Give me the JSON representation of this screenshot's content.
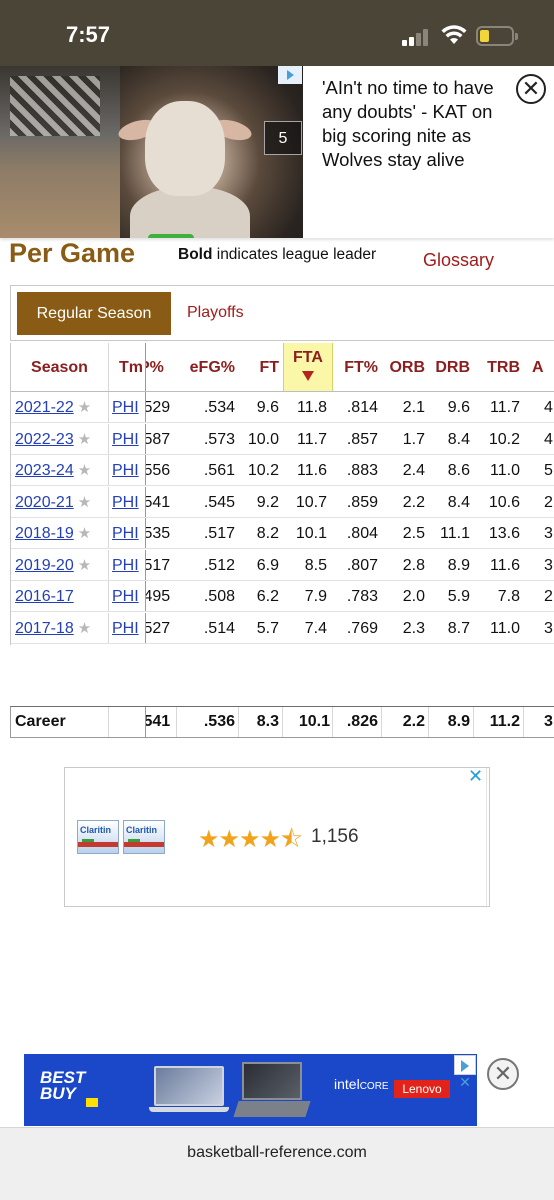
{
  "status_bar": {
    "time": "7:57"
  },
  "top_ad": {
    "counter": "5",
    "headline": "'AIn't no time to have any doubts' - KAT on big scoring nite as Wolves stay alive",
    "close_symbol": "✕"
  },
  "header": {
    "title": "Per Game",
    "note_bold": "Bold",
    "note_rest": " indicates league leader",
    "glossary": "Glossary"
  },
  "tabs": {
    "active": "Regular Season",
    "other": "Playoffs"
  },
  "table": {
    "columns": {
      "season": "Season",
      "tm": "Tm",
      "p": "P%",
      "efg": "eFG%",
      "ft": "FT",
      "fta": "FTA",
      "ftp": "FT%",
      "orb": "ORB",
      "drb": "DRB",
      "trb": "TRB",
      "a": "A"
    },
    "rows": [
      {
        "season": "2021-22",
        "tm": "PHI",
        "p": ".529",
        "efg": ".534",
        "ft": "9.6",
        "fta": "11.8",
        "ftp": ".814",
        "orb": "2.1",
        "drb": "9.6",
        "trb": "11.7",
        "a": "4"
      },
      {
        "season": "2022-23",
        "tm": "PHI",
        "p": ".587",
        "efg": ".573",
        "ft": "10.0",
        "fta": "11.7",
        "ftp": ".857",
        "orb": "1.7",
        "drb": "8.4",
        "trb": "10.2",
        "a": "4"
      },
      {
        "season": "2023-24",
        "tm": "PHI",
        "p": ".556",
        "efg": ".561",
        "ft": "10.2",
        "fta": "11.6",
        "ftp": ".883",
        "orb": "2.4",
        "drb": "8.6",
        "trb": "11.0",
        "a": "5"
      },
      {
        "season": "2020-21",
        "tm": "PHI",
        "p": ".541",
        "efg": ".545",
        "ft": "9.2",
        "fta": "10.7",
        "ftp": ".859",
        "orb": "2.2",
        "drb": "8.4",
        "trb": "10.6",
        "a": "2"
      },
      {
        "season": "2018-19",
        "tm": "PHI",
        "p": ".535",
        "efg": ".517",
        "ft": "8.2",
        "fta": "10.1",
        "ftp": ".804",
        "orb": "2.5",
        "drb": "11.1",
        "trb": "13.6",
        "a": "3"
      },
      {
        "season": "2019-20",
        "tm": "PHI",
        "p": ".517",
        "efg": ".512",
        "ft": "6.9",
        "fta": "8.5",
        "ftp": ".807",
        "orb": "2.8",
        "drb": "8.9",
        "trb": "11.6",
        "a": "3"
      },
      {
        "season": "2016-17",
        "tm": "PHI",
        "p": ".495",
        "efg": ".508",
        "ft": "6.2",
        "fta": "7.9",
        "ftp": ".783",
        "orb": "2.0",
        "drb": "5.9",
        "trb": "7.8",
        "a": "2"
      },
      {
        "season": "2017-18",
        "tm": "PHI",
        "p": ".527",
        "efg": ".514",
        "ft": "5.7",
        "fta": "7.4",
        "ftp": ".769",
        "orb": "2.3",
        "drb": "8.7",
        "trb": "11.0",
        "a": "3"
      }
    ],
    "starred": [
      true,
      true,
      true,
      true,
      true,
      true,
      false,
      true
    ],
    "career": {
      "label": "Career",
      "p": ".541",
      "efg": ".536",
      "ft": "8.3",
      "fta": "10.1",
      "ftp": ".826",
      "orb": "2.2",
      "drb": "8.9",
      "trb": "11.2",
      "a": "3"
    }
  },
  "product_ad": {
    "brand": "Claritin",
    "rating_stars": "★★★★⯪",
    "rating": 4.5,
    "reviews": "1,156",
    "close_symbol": "✕"
  },
  "bottom_banner": {
    "brand": "BEST BUY",
    "intel_text": "intel",
    "core_text": "CORE",
    "partner": "Lenovo",
    "x_symbol": "✕",
    "close_symbol": "✕"
  },
  "url_bar": {
    "url": "basketball-reference.com"
  },
  "colors": {
    "brand_brown": "#8a5b14",
    "link_red": "#a11c1c",
    "link_blue": "#2340b8",
    "highlight": "#fbf7a8",
    "bestbuy_blue": "#1a48c9"
  }
}
